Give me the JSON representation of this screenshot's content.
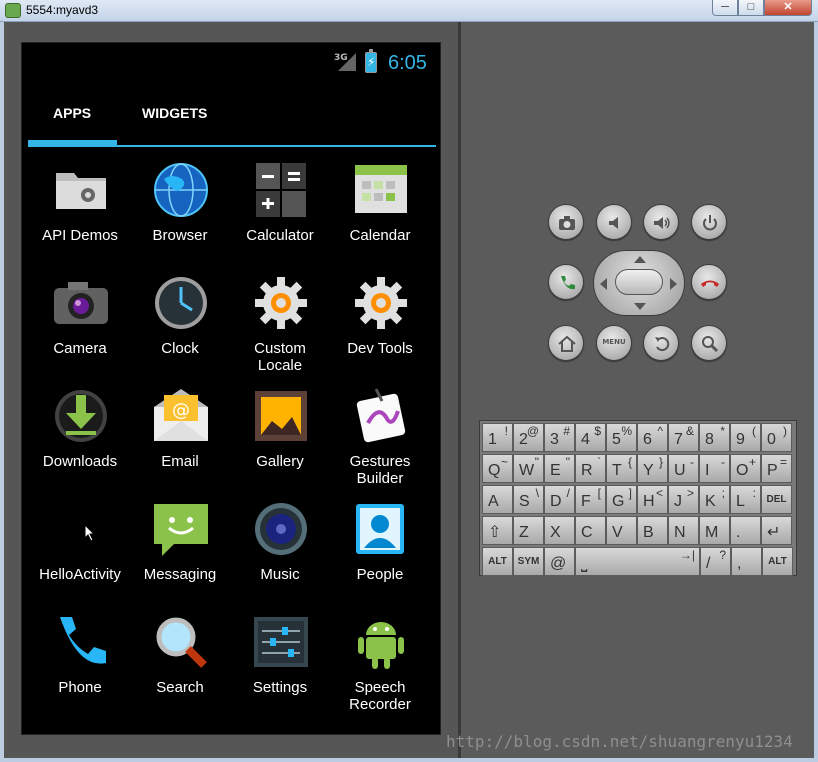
{
  "window": {
    "title": "5554:myavd3",
    "minimize": "─",
    "maximize": "□",
    "close": "✕"
  },
  "status_bar": {
    "network": "3G",
    "time": "6:05",
    "battery_glyph": "⚡"
  },
  "tabs": [
    {
      "label": "APPS",
      "selected": true
    },
    {
      "label": "WIDGETS",
      "selected": false
    }
  ],
  "apps": [
    {
      "label": "API Demos",
      "icon": "folder-gear-icon"
    },
    {
      "label": "Browser",
      "icon": "globe-icon"
    },
    {
      "label": "Calculator",
      "icon": "calculator-icon"
    },
    {
      "label": "Calendar",
      "icon": "calendar-icon"
    },
    {
      "label": "Camera",
      "icon": "camera-icon"
    },
    {
      "label": "Clock",
      "icon": "clock-icon"
    },
    {
      "label": "Custom\nLocale",
      "icon": "gear-orange-icon"
    },
    {
      "label": "Dev Tools",
      "icon": "gear-orange-icon"
    },
    {
      "label": "Downloads",
      "icon": "download-icon"
    },
    {
      "label": "Email",
      "icon": "email-icon"
    },
    {
      "label": "Gallery",
      "icon": "gallery-icon"
    },
    {
      "label": "Gestures\nBuilder",
      "icon": "gesture-icon"
    },
    {
      "label": "HelloActivity",
      "icon": "blank-icon"
    },
    {
      "label": "Messaging",
      "icon": "message-icon"
    },
    {
      "label": "Music",
      "icon": "speaker-icon"
    },
    {
      "label": "People",
      "icon": "contact-icon"
    },
    {
      "label": "Phone",
      "icon": "phone-icon"
    },
    {
      "label": "Search",
      "icon": "magnifier-icon"
    },
    {
      "label": "Settings",
      "icon": "sliders-icon"
    },
    {
      "label": "Speech\nRecorder",
      "icon": "android-icon"
    }
  ],
  "controls": {
    "menu_label": "MENU"
  },
  "keyboard": {
    "rows": [
      [
        [
          "1",
          "!"
        ],
        [
          "2",
          "@"
        ],
        [
          "3",
          "#"
        ],
        [
          "4",
          "$"
        ],
        [
          "5",
          "%"
        ],
        [
          "6",
          "^"
        ],
        [
          "7",
          "&"
        ],
        [
          "8",
          "*"
        ],
        [
          "9",
          "("
        ],
        [
          "0",
          ")"
        ]
      ],
      [
        [
          "Q",
          "~"
        ],
        [
          "W",
          "\""
        ],
        [
          "E",
          "\""
        ],
        [
          "R",
          "`"
        ],
        [
          "T",
          "{"
        ],
        [
          "Y",
          "}"
        ],
        [
          "U",
          "-"
        ],
        [
          "I",
          "-"
        ],
        [
          "O",
          "+"
        ],
        [
          "P",
          "="
        ]
      ],
      [
        [
          "A",
          ""
        ],
        [
          "S",
          "\\"
        ],
        [
          "D",
          "/"
        ],
        [
          "F",
          "["
        ],
        [
          "G",
          "]"
        ],
        [
          "H",
          "<"
        ],
        [
          "J",
          ">"
        ],
        [
          "K",
          ";"
        ],
        [
          "L",
          ":"
        ],
        [
          "DEL",
          ""
        ]
      ],
      [
        [
          "⇧",
          ""
        ],
        [
          "Z",
          ""
        ],
        [
          "X",
          ""
        ],
        [
          "C",
          ""
        ],
        [
          "V",
          ""
        ],
        [
          "B",
          ""
        ],
        [
          "N",
          ""
        ],
        [
          "M",
          ""
        ],
        [
          ".",
          ""
        ],
        [
          "↵",
          ""
        ]
      ],
      [
        [
          "ALT",
          ""
        ],
        [
          "SYM",
          ""
        ],
        [
          "@",
          ""
        ],
        [
          "⎵",
          "→|"
        ],
        [
          "/",
          "?"
        ],
        [
          ",",
          ""
        ],
        [
          "ALT",
          ""
        ]
      ]
    ]
  },
  "watermark": "http://blog.csdn.net/shuangrenyu1234"
}
